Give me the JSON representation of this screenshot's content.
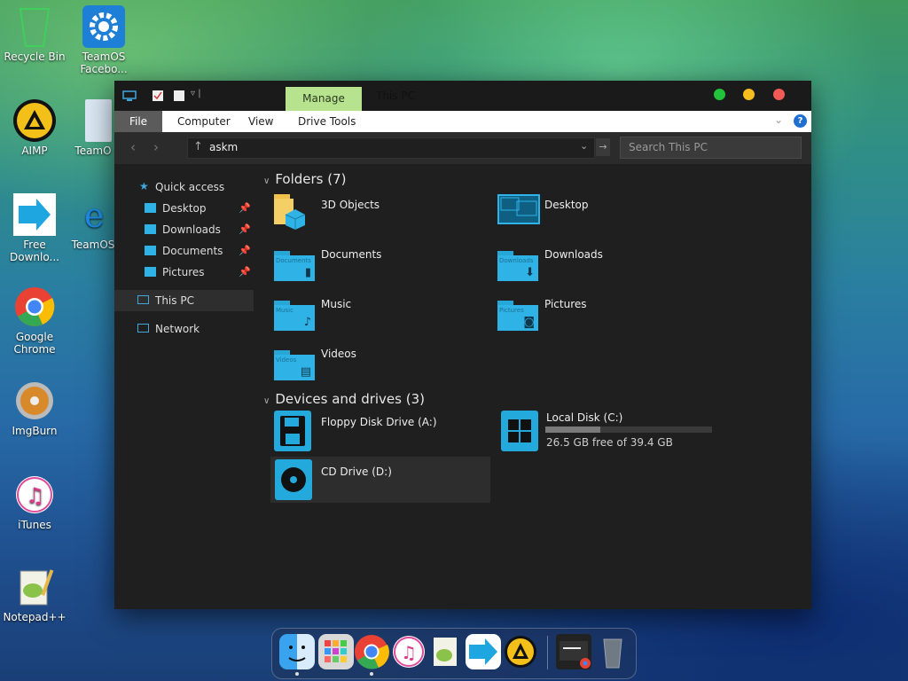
{
  "desktop": {
    "icons": [
      {
        "label": "Recycle Bin"
      },
      {
        "label": "TeamOS Facebo..."
      },
      {
        "label": "AIMP"
      },
      {
        "label": "TeamO"
      },
      {
        "label": "Free Downlo..."
      },
      {
        "label": "TeamOS"
      },
      {
        "label": "Google Chrome"
      },
      {
        "label": "ImgBurn"
      },
      {
        "label": "iTunes"
      },
      {
        "label": "Notepad++"
      }
    ]
  },
  "window": {
    "title": "This PC",
    "contextual_tab": "Manage",
    "controls": {
      "colors": [
        "#22c33a",
        "#f5bd1f",
        "#f25b55"
      ]
    },
    "ribbon_tabs": [
      "File",
      "Computer",
      "View",
      "Drive Tools"
    ],
    "address": {
      "value": "askm"
    },
    "search": {
      "placeholder": "Search This PC"
    },
    "nav": {
      "quick_access": "Quick access",
      "pinned": [
        {
          "label": "Desktop"
        },
        {
          "label": "Downloads"
        },
        {
          "label": "Documents"
        },
        {
          "label": "Pictures"
        }
      ],
      "this_pc": "This PC",
      "network": "Network"
    },
    "folders": {
      "heading": "Folders (7)",
      "items": [
        {
          "label": "3D Objects",
          "icon": "3d-objects-folder-icon"
        },
        {
          "label": "Desktop",
          "icon": "desktop-folder-icon"
        },
        {
          "label": "Documents",
          "icon": "documents-folder-icon",
          "tag": "Documents"
        },
        {
          "label": "Downloads",
          "icon": "downloads-folder-icon",
          "tag": "Downloads"
        },
        {
          "label": "Music",
          "icon": "music-folder-icon",
          "tag": "Music"
        },
        {
          "label": "Pictures",
          "icon": "pictures-folder-icon",
          "tag": "Pictures"
        },
        {
          "label": "Videos",
          "icon": "videos-folder-icon",
          "tag": "Videos"
        }
      ]
    },
    "drives": {
      "heading": "Devices and drives (3)",
      "items": [
        {
          "label": "Floppy Disk Drive (A:)",
          "icon": "floppy-icon"
        },
        {
          "label": "Local Disk (C:)",
          "icon": "windows-drive-icon",
          "free": "26.5 GB free of 39.4 GB",
          "used_fraction": 0.33
        },
        {
          "label": "CD Drive (D:)",
          "icon": "cd-icon"
        }
      ]
    }
  },
  "colors": {
    "accent": "#2fb3e6",
    "manage_tab": "#b7e38f",
    "window_bg": "#1f1f1f"
  }
}
